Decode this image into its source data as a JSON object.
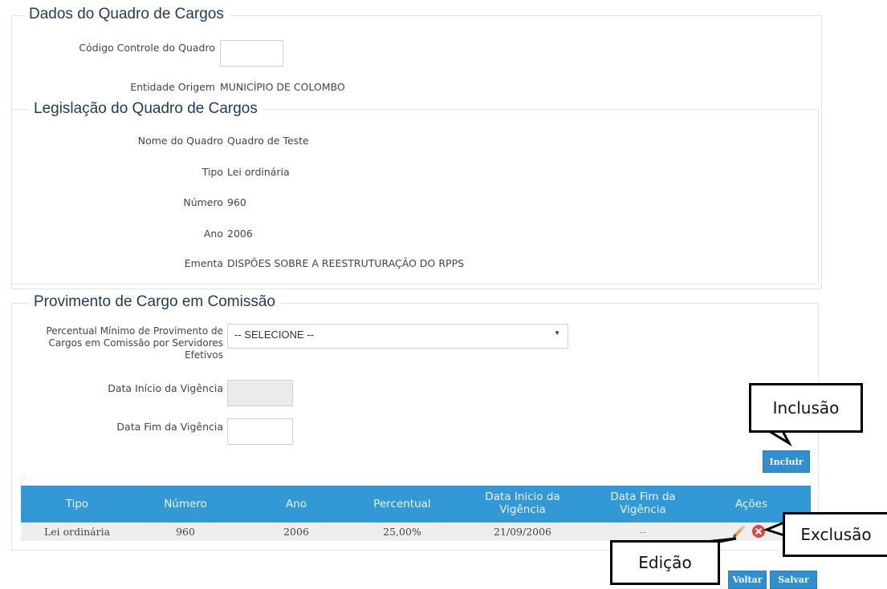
{
  "section1": {
    "legend": "Dados do Quadro de Cargos",
    "codigo_label": "Código Controle do Quadro",
    "codigo_value": "",
    "entidade_label": "Entidade Origem",
    "entidade_value": "MUNICÍPIO DE COLOMBO"
  },
  "section2": {
    "legend": "Legislação do Quadro de Cargos",
    "fields": [
      {
        "label": "Nome do Quadro",
        "value": "Quadro de Teste"
      },
      {
        "label": "Tipo",
        "value": "Lei ordinária"
      },
      {
        "label": "Número",
        "value": "960"
      },
      {
        "label": "Ano",
        "value": "2006"
      },
      {
        "label": "Ementa",
        "value": "DISPÕES SOBRE A REESTRUTURAÇÃO DO RPPS"
      }
    ]
  },
  "section3": {
    "legend": "Provimento de Cargo em Comissão",
    "percentual_label_1": "Percentual Mínimo de Provimento de",
    "percentual_label_2": "Cargos em Comissão por Servidores",
    "percentual_label_3": "Efetivos",
    "percentual_select": "-- SELECIONE --",
    "data_inicio_label": "Data Início da Vigência",
    "data_fim_label": "Data Fim da Vigência",
    "incluir_label": "Incluir"
  },
  "table": {
    "headers": [
      {
        "l1": "Tipo",
        "l2": ""
      },
      {
        "l1": "Número",
        "l2": ""
      },
      {
        "l1": "Ano",
        "l2": ""
      },
      {
        "l1": "Percentual",
        "l2": ""
      },
      {
        "l1": "Data Inicio da",
        "l2": "Vigência"
      },
      {
        "l1": "Data Fim da",
        "l2": "Vigência"
      },
      {
        "l1": "Ações",
        "l2": ""
      }
    ],
    "rows": [
      [
        "Lei ordinária",
        "960",
        "2006",
        "25,00%",
        "21/09/2006",
        "--"
      ]
    ]
  },
  "footer": {
    "voltar_label": "Voltar",
    "salvar_label": "Salvar"
  },
  "callouts": {
    "inclusao": "Inclusão",
    "exclusao": "Exclusão",
    "edicao": "Edição"
  },
  "colors": {
    "accent": "#3399d6",
    "delete": "#e0443e",
    "edit": "#e8a040"
  },
  "icons": [
    "pencil-icon",
    "delete-circle-icon",
    "chevron-down-icon"
  ]
}
